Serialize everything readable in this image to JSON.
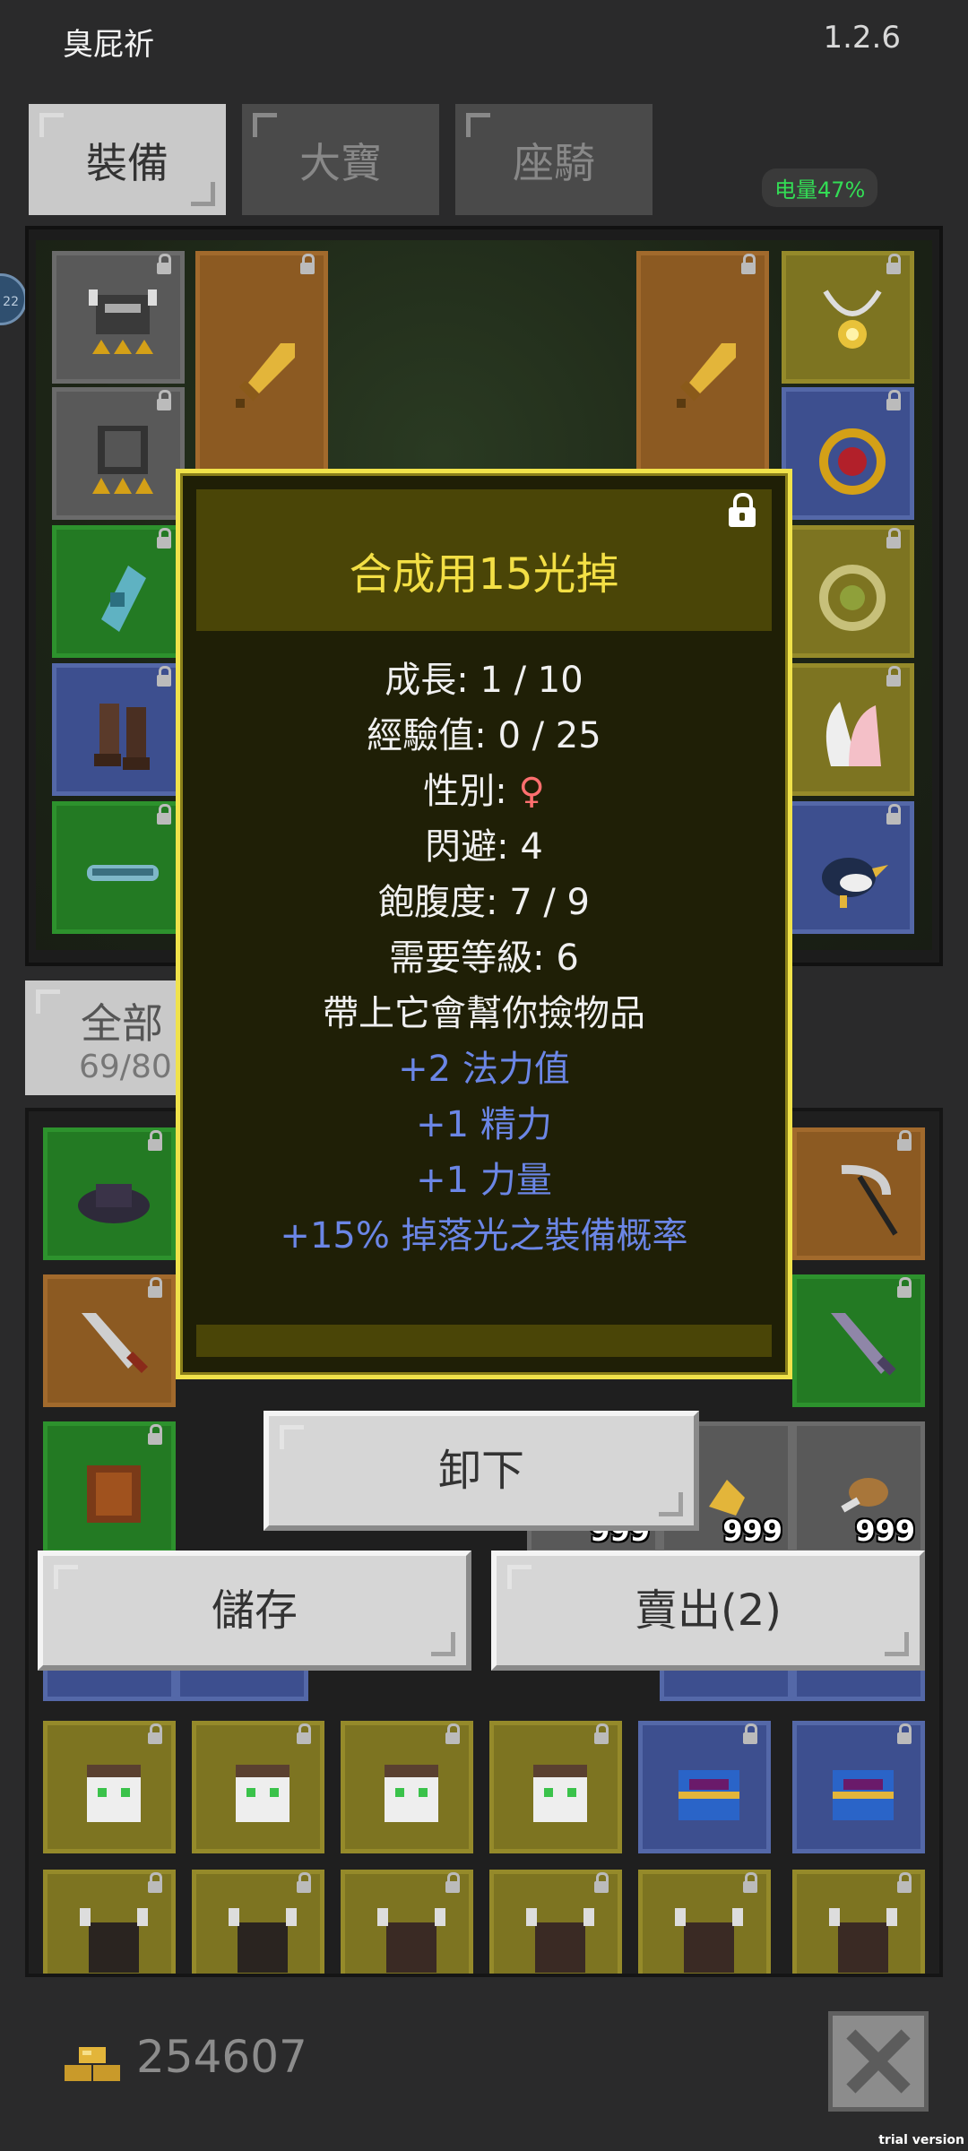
{
  "header": {
    "title": "臭屁祈",
    "version": "1.2.6"
  },
  "status": {
    "battery": "电量47%",
    "side_badge": "22"
  },
  "tabs": [
    {
      "label": "裝備",
      "active": true
    },
    {
      "label": "大寶",
      "active": false
    },
    {
      "label": "座騎",
      "active": false
    }
  ],
  "inventory_filter": {
    "label": "全部",
    "count": "69/80"
  },
  "stack_counts": {
    "a": "999",
    "b": "999",
    "c": "999"
  },
  "popup": {
    "title": "合成用15光掉",
    "stats": {
      "growth": "成長: 1 / 10",
      "exp": "經驗值: 0 / 25",
      "gender_label": "性別: ",
      "gender_symbol": "♀",
      "dodge": "閃避: 4",
      "satiety": "飽腹度: 7 / 9",
      "level_req": "需要等級: 6",
      "desc": "帶上它會幫你撿物品"
    },
    "bonuses": {
      "mana": "+2 法力值",
      "spirit": "+1 精力",
      "strength": "+1 力量",
      "drop": "+15% 掉落光之裝備概率"
    }
  },
  "actions": {
    "unequip": "卸下",
    "store": "儲存",
    "sell": "賣出(2)"
  },
  "footer": {
    "gold": "254607",
    "watermark": "trial version"
  },
  "colors": {
    "popup_border": "#f0e24a",
    "popup_title": "#f3df45",
    "bonus_text": "#6b86e6",
    "battery": "#33dd55"
  }
}
